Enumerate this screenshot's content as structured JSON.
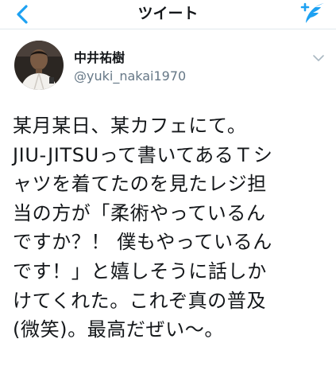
{
  "header": {
    "title": "ツイート",
    "back_icon": "chevron-left-icon",
    "compose_icon": "compose-tweet-icon",
    "accent_color": "#1da1f2"
  },
  "user": {
    "display_name": "中井祐樹",
    "handle": "@yuki_nakai1970",
    "caret_icon": "chevron-down-icon"
  },
  "tweet": {
    "lines": [
      "某月某日、某カフェにて。",
      "JIU-JITSUって書いてあるＴシ",
      "ャツを着てたのを見たレジ担",
      "当の方が「柔術やっているん",
      "ですか？！ 僕もやっているん",
      "です！」と嬉しそうに話しか",
      "けてくれた。これぞ真の普及",
      "(微笑)。最高だぜい〜。"
    ]
  }
}
